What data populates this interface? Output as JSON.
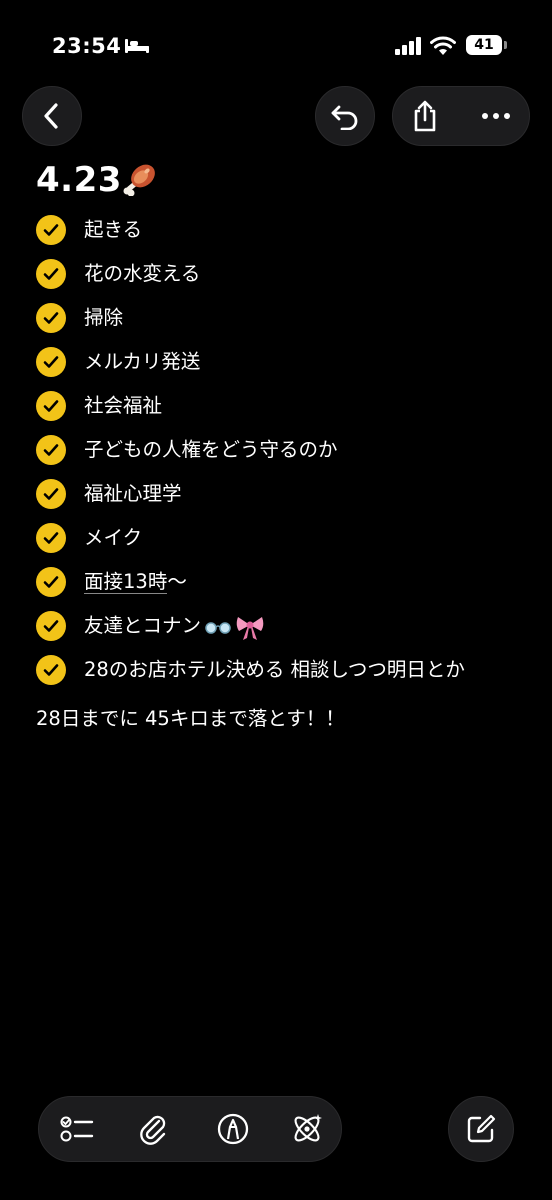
{
  "status_bar": {
    "time": "23:54",
    "battery": "41"
  },
  "note": {
    "title": "4.23",
    "items": [
      {
        "text": "起きる",
        "checked": true
      },
      {
        "text": "花の水変える",
        "checked": true
      },
      {
        "text": "掃除",
        "checked": true
      },
      {
        "text": "メルカリ発送",
        "checked": true
      },
      {
        "text": "社会福祉",
        "checked": true
      },
      {
        "text": "子どもの人権をどう守るのか",
        "checked": true
      },
      {
        "text": "福祉心理学",
        "checked": true
      },
      {
        "text": "メイク",
        "checked": true
      },
      {
        "text_underlined": "面接13時",
        "text_after": "〜",
        "checked": true
      },
      {
        "text": "友達とコナン",
        "checked": true
      },
      {
        "text": "28のお店ホテル決める 相談しつつ明日とか",
        "checked": true
      }
    ],
    "free_text": "28日までに 45キロまで落とす！！"
  },
  "icons": {
    "top_bar": [
      "back-icon",
      "undo-icon",
      "share-icon",
      "more-icon"
    ],
    "title_emoji": "meat-on-bone-icon",
    "item_emoji": [
      "glasses-icon",
      "ribbon-icon"
    ],
    "toolbar": [
      "checklist-icon",
      "attachment-icon",
      "markup-icon",
      "ai-icon",
      "compose-icon"
    ]
  },
  "colors": {
    "background": "#000000",
    "checkbox": "#f2c318",
    "button_bg": "#1c1c1e"
  }
}
